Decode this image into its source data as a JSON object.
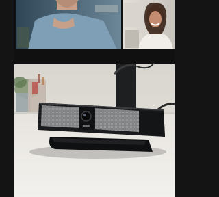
{
  "image": {
    "subject": "webcam-soundbar-product-photo",
    "colors": {
      "frame": "#141414",
      "wall": "#d9d6d0",
      "desk": "#eeebe6",
      "device_body": "#1b1c1e",
      "device_grille": "#8e8f90"
    }
  }
}
